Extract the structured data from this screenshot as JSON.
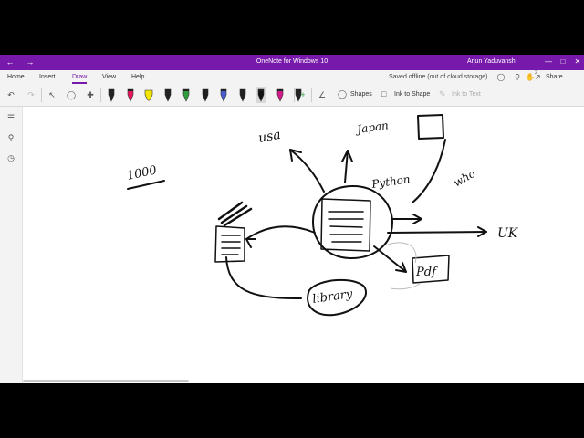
{
  "window": {
    "title": "OneNote for Windows 10",
    "user": "Arjun Yaduvanshi",
    "back_icon": "back-arrow-icon",
    "forward_icon": "forward-arrow-icon"
  },
  "ribbon": {
    "tabs": [
      {
        "label": "Home"
      },
      {
        "label": "Insert"
      },
      {
        "label": "Draw",
        "active": true
      },
      {
        "label": "View"
      },
      {
        "label": "Help"
      }
    ],
    "status": "Saved offline (out of cloud storage)",
    "notification_count": "2",
    "share_label": "Share"
  },
  "toolbar": {
    "shapes_label": "Shapes",
    "ink_to_shape_label": "Ink to Shape",
    "ink_to_text_label": "Ink to Text",
    "pens": [
      {
        "kind": "pen",
        "color": "#222222"
      },
      {
        "kind": "pen",
        "color": "#e8175d"
      },
      {
        "kind": "highlighter",
        "color": "#f2e600"
      },
      {
        "kind": "pen",
        "color": "#222222"
      },
      {
        "kind": "pen",
        "color": "#2e9e3f"
      },
      {
        "kind": "pen",
        "color": "#1f1f1f"
      },
      {
        "kind": "pen",
        "color": "#4a5bd0"
      },
      {
        "kind": "pen",
        "color": "#222222"
      },
      {
        "kind": "pen",
        "color": "#111111",
        "selected": true
      },
      {
        "kind": "pen",
        "color": "#d11a8c"
      },
      {
        "kind": "pen",
        "color": "#222222"
      }
    ]
  },
  "colors": {
    "accent": "#7719aa",
    "toolbar_bg": "#f3f3f3",
    "ink": "#111111"
  },
  "canvas": {
    "ink_words": {
      "note_1000": "1000",
      "usa": "usa",
      "japan": "Japan",
      "python": "Python",
      "pdf": "Pdf",
      "uk": "UK",
      "library": "library",
      "who": "who"
    }
  }
}
